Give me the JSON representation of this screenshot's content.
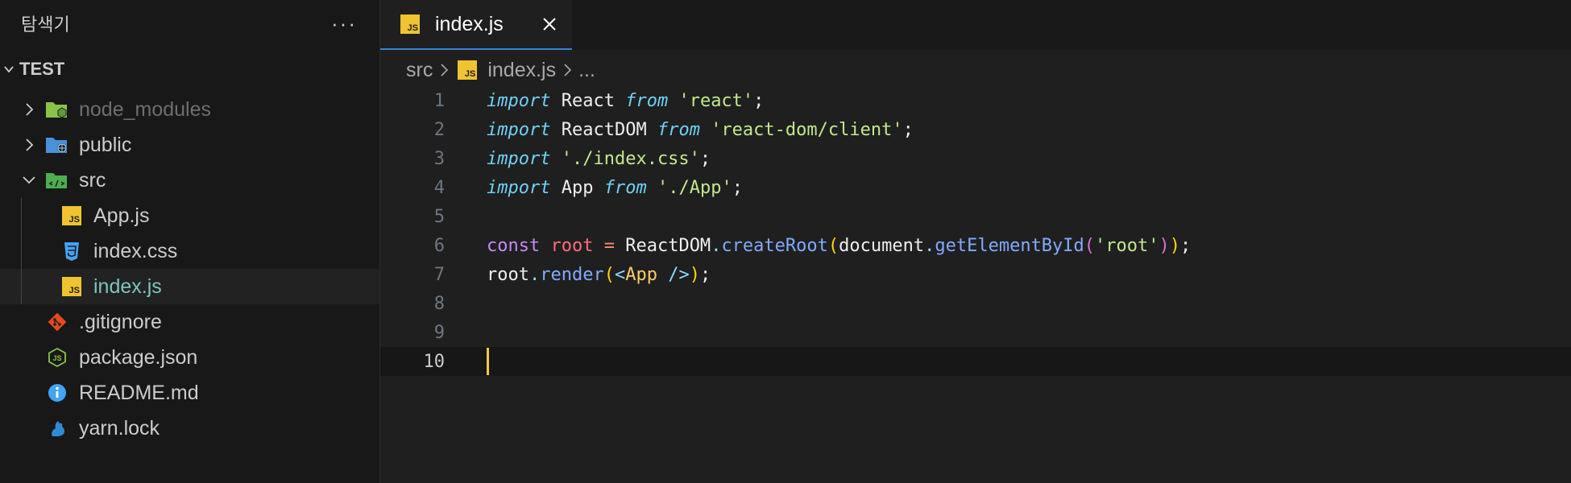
{
  "explorer": {
    "title": "탐색기",
    "more": "···",
    "section": "TEST",
    "tree": [
      {
        "label": "node_modules",
        "icon": "node-modules-folder-icon",
        "expanded": false,
        "dim": true
      },
      {
        "label": "public",
        "icon": "public-folder-icon",
        "expanded": false
      },
      {
        "label": "src",
        "icon": "src-folder-icon",
        "expanded": true
      },
      {
        "label": "App.js",
        "icon": "js-file-icon"
      },
      {
        "label": "index.css",
        "icon": "css-file-icon"
      },
      {
        "label": "index.js",
        "icon": "js-file-icon",
        "selected": true
      },
      {
        "label": ".gitignore",
        "icon": "git-icon"
      },
      {
        "label": "package.json",
        "icon": "nodejs-icon"
      },
      {
        "label": "README.md",
        "icon": "info-icon"
      },
      {
        "label": "yarn.lock",
        "icon": "yarn-icon"
      }
    ]
  },
  "tab": {
    "label": "index.js",
    "badge": "JS"
  },
  "breadcrumb": {
    "folder": "src",
    "file": "index.js",
    "more": "..."
  },
  "code": {
    "line_numbers": [
      "1",
      "2",
      "3",
      "4",
      "5",
      "6",
      "7",
      "8",
      "9",
      "10"
    ],
    "current_line": 10,
    "tokens": {
      "import": "import",
      "from": "from",
      "const": "const",
      "react_id": "React",
      "react_str": "'react'",
      "reactdom_id": "ReactDOM",
      "reactdom_str": "'react-dom/client'",
      "css_str": "'./index.css'",
      "app_id": "App",
      "app_str": "'./App'",
      "semi": ";",
      "root_var": "root",
      "eq": "=",
      "createRoot": "createRoot",
      "document": "document",
      "getElementById": "getElementById",
      "root_str": "'root'",
      "render": "render",
      "jsx_open": "<",
      "jsx_close": "/>"
    }
  },
  "colors": {
    "accent": "#3b82d6",
    "js_badge": "#f0c330",
    "cursor": "#f5c842"
  }
}
